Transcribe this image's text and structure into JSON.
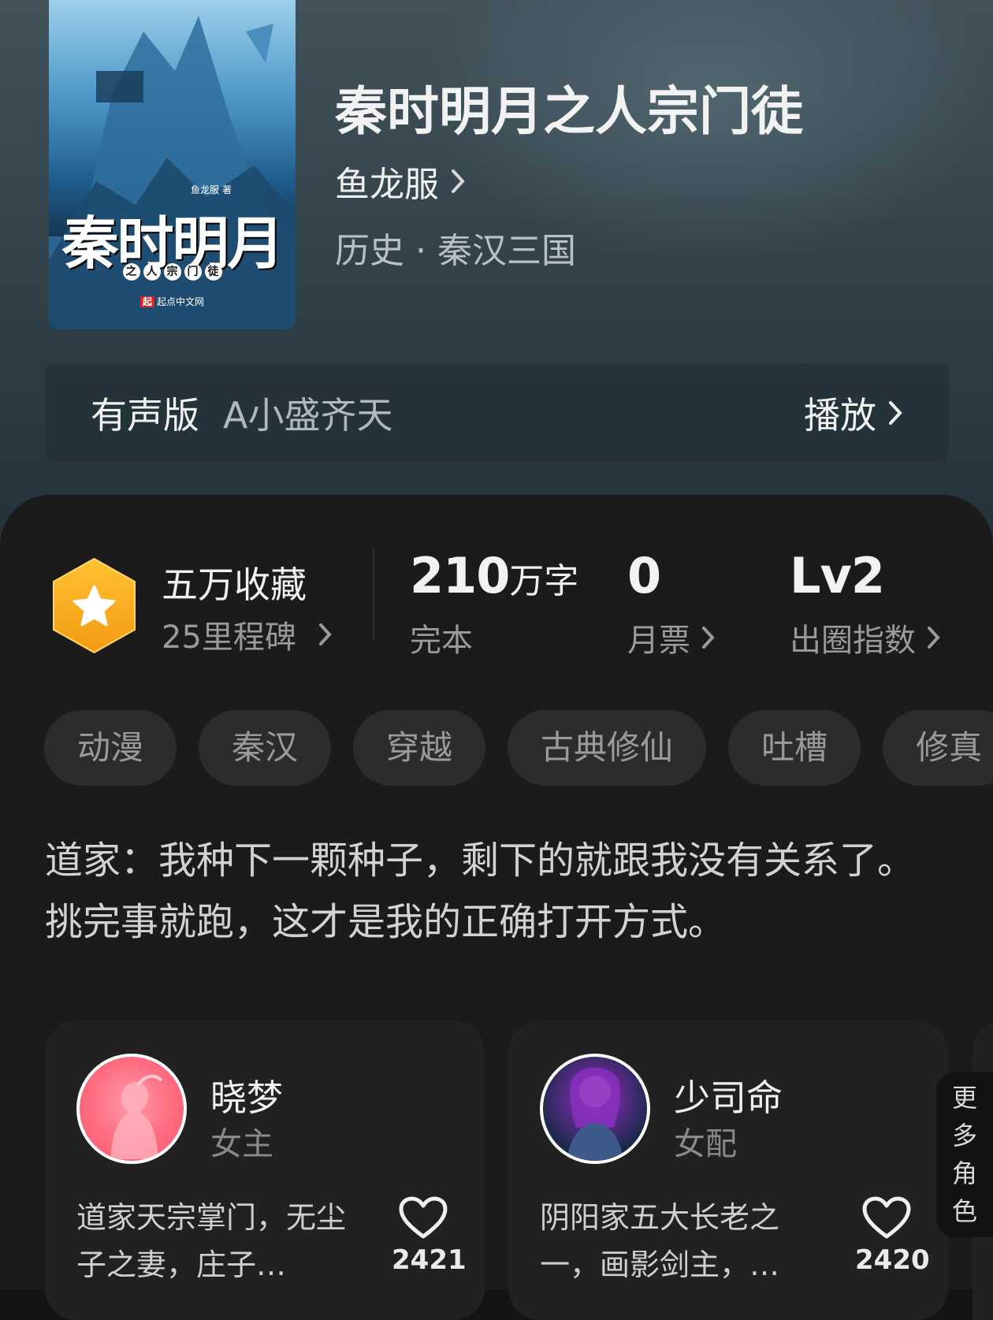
{
  "book": {
    "title": "秦时明月之人宗门徒",
    "author": "鱼龙服",
    "genre": "历史 · 秦汉三国",
    "cover": {
      "title": "秦时明月",
      "subtitle_chars": [
        "之",
        "人",
        "宗",
        "门",
        "徒"
      ],
      "author_credit": "鱼龙服 著",
      "brand": "起点中文网"
    }
  },
  "audio": {
    "label": "有声版",
    "narrator": "A小盛齐天",
    "play_label": "播放"
  },
  "stats": {
    "milestone": {
      "title": "五万收藏",
      "subtitle": "25里程碑"
    },
    "words": {
      "value": "210",
      "unit": "万字",
      "label": "完本"
    },
    "monthly_votes": {
      "value": "0",
      "label": "月票"
    },
    "popularity": {
      "value": "Lv2",
      "label": "出圈指数"
    }
  },
  "tags": [
    "动漫",
    "秦汉",
    "穿越",
    "古典修仙",
    "吐槽",
    "修真"
  ],
  "summary": "道家：我种下一颗种子，剩下的就跟我没有关系了。挑完事就跑，这才是我的正确打开方式。",
  "characters": [
    {
      "name": "晓梦",
      "role": "女主",
      "desc": "道家天宗掌门，无尘子之妻，庄子…",
      "likes": "2421"
    },
    {
      "name": "少司命",
      "role": "女配",
      "desc": "阴阳家五大长老之一，画影剑主，…",
      "likes": "2420"
    }
  ],
  "more_roles": [
    "更",
    "多",
    "角",
    "色"
  ],
  "colors": {
    "badge_orange": "#F5A623",
    "page_bg": "#1B1B1B",
    "hero_bg": "#3A4A52"
  }
}
